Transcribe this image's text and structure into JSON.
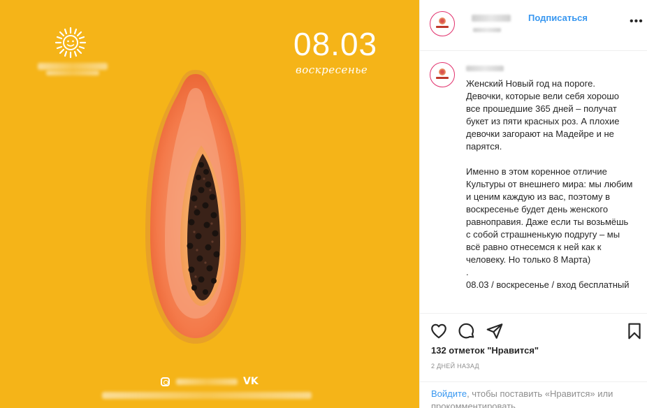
{
  "image": {
    "date": "08.03",
    "day": "воскресенье",
    "background_color": "#f5b418",
    "icons": [
      "sun-logo-icon",
      "papaya-icon",
      "instagram-icon",
      "vk-icon"
    ]
  },
  "header": {
    "subscribe_label": "Подписаться",
    "more_icon": "more-horizontal-icon",
    "more_glyph": "•••"
  },
  "caption": "Женский Новый год на пороге. Девочки, которые вели себя хорошо все прошедшие 365 дней – получат букет из пяти красных роз. А плохие девочки загорают на Мадейре и не парятся.\n\nИменно в этом коренное отличие Культуры от внешнего мира: мы любим и ценим каждую из вас, поэтому в воскресенье будет день женского равноправия. Даже если ты возьмёшь с собой страшненькую подругу – мы всё равно отнесемся к ней как к человеку. Но только 8 Марта)\n.\n08.03 / воскресенье / вход бесплатный",
  "actions": {
    "icons": [
      "heart-icon",
      "comment-icon",
      "share-icon",
      "bookmark-icon"
    ]
  },
  "likes": "132 отметок \"Нравится\"",
  "post_date": "2 ДНЕЙ НАЗАД",
  "login": {
    "link": "Войдите",
    "text": ", чтобы поставить «Нравится» или прокомментировать."
  },
  "colors": {
    "accent": "#3897f0",
    "muted": "#8e8e8e",
    "text": "#262626"
  }
}
